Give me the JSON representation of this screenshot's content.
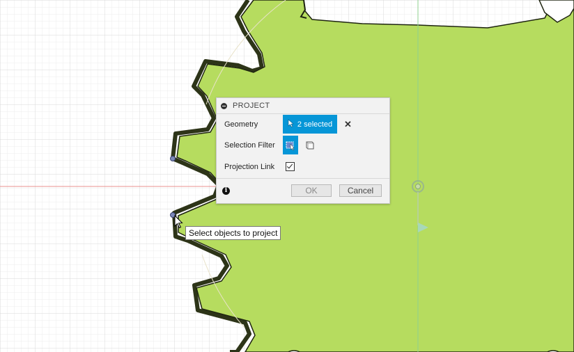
{
  "dialog": {
    "title": "PROJECT",
    "geometry_label": "Geometry",
    "geometry_selection": "2 selected",
    "selection_filter_label": "Selection Filter",
    "projection_link_label": "Projection Link",
    "projection_link_checked": true,
    "ok_label": "OK",
    "cancel_label": "Cancel"
  },
  "tooltip": {
    "text": "Select objects to project"
  },
  "colors": {
    "gear_fill": "#b6dc5f",
    "accent_blue": "#0696d7",
    "grid_line": "#e3e3e3",
    "x_axis": "#e8908f",
    "y_axis": "#8fd08f"
  },
  "icons": {
    "collapse": "collapse-icon",
    "clear": "clear-selection-icon",
    "info": "info-icon",
    "filter_bodies": "select-bodies-filter-icon",
    "filter_components": "select-components-filter-icon",
    "cursor": "mouse-pointer-icon"
  }
}
